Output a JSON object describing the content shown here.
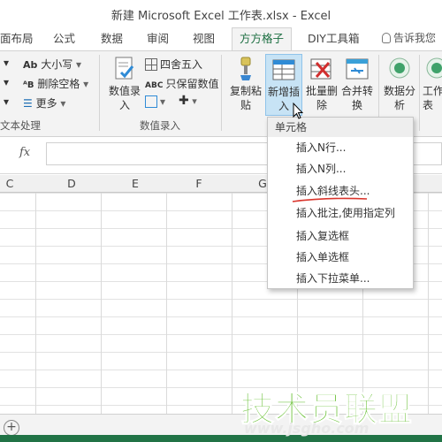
{
  "window": {
    "title": "新建 Microsoft Excel 工作表.xlsx - Excel"
  },
  "tabs": [
    {
      "label": "面布局"
    },
    {
      "label": "公式"
    },
    {
      "label": "数据"
    },
    {
      "label": "审阅"
    },
    {
      "label": "视图"
    },
    {
      "label": "方方格子",
      "active": true
    },
    {
      "label": "DIY工具箱"
    }
  ],
  "tell_me": "告诉我您",
  "ribbon": {
    "text_group": {
      "items": [
        "大小写",
        "删除空格",
        "更多"
      ],
      "label": "文本处理",
      "left_label": "数值录入"
    },
    "number_group": {
      "numvalue_btn": "数值录\n入",
      "round": "四舍五入",
      "keep_value": "只保留数值",
      "label": "数值录入"
    },
    "copy_btn": "复制粘\n贴",
    "insert_btn": "新增插\n入",
    "batch_delete_btn": "批量删\n除",
    "merge_btn": "合并转\n换",
    "analysis_btn": "数据分\n析",
    "worksheet_btn": "工作\n表"
  },
  "formula_bar": {
    "fx": "fx",
    "value": ""
  },
  "columns": [
    "C",
    "D",
    "E",
    "F",
    "G"
  ],
  "dropdown": {
    "header": "单元格",
    "items": [
      "插入N行...",
      "插入N列...",
      "插入斜线表头...",
      "插入批注,使用指定列",
      "插入复选框",
      "插入单选框",
      "插入下拉菜单..."
    ]
  },
  "statusbar": {
    "add_sheet": "+"
  },
  "watermark": {
    "text": "技术员联盟",
    "url": "www.jsgho.com"
  },
  "colors": {
    "accent": "#1d6f42",
    "pressed": "#c7e3f5",
    "watermark": "#6cc23a",
    "underline": "#d9342b"
  }
}
